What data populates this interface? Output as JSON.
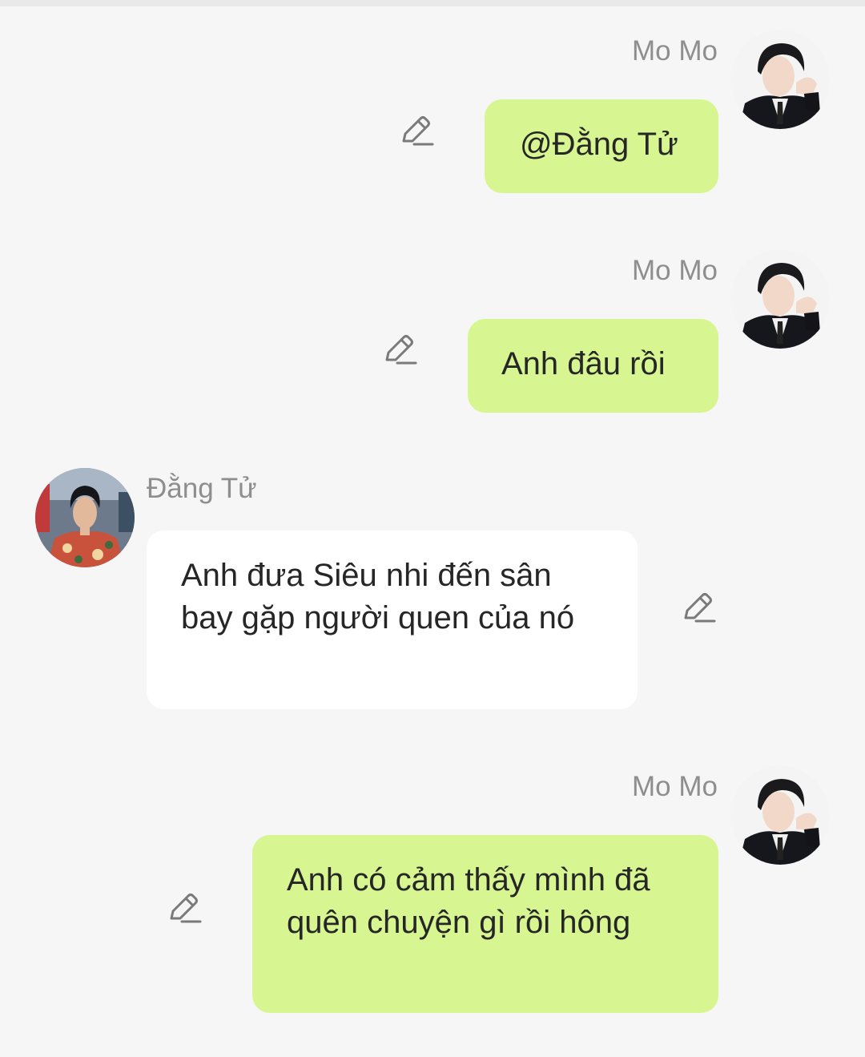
{
  "colors": {
    "background": "#f6f6f6",
    "outgoing_bubble": "#d7f691",
    "incoming_bubble": "#ffffff",
    "name_text": "#8e8e8e",
    "message_text": "#262626"
  },
  "messages": [
    {
      "sender": "Mo Mo",
      "direction": "outgoing",
      "text": "@Đằng Tử",
      "edit_icon": "pencil-edit-icon"
    },
    {
      "sender": "Mo Mo",
      "direction": "outgoing",
      "text": "Anh đâu rồi",
      "edit_icon": "pencil-edit-icon"
    },
    {
      "sender": "Đằng Tử",
      "direction": "incoming",
      "text": "Anh đưa Siêu nhi đến sân bay gặp người quen của nó",
      "edit_icon": "pencil-edit-icon"
    },
    {
      "sender": "Mo Mo",
      "direction": "outgoing",
      "text": "Anh có cảm thấy mình đã quên chuyện gì rồi hông",
      "edit_icon": "pencil-edit-icon"
    }
  ]
}
